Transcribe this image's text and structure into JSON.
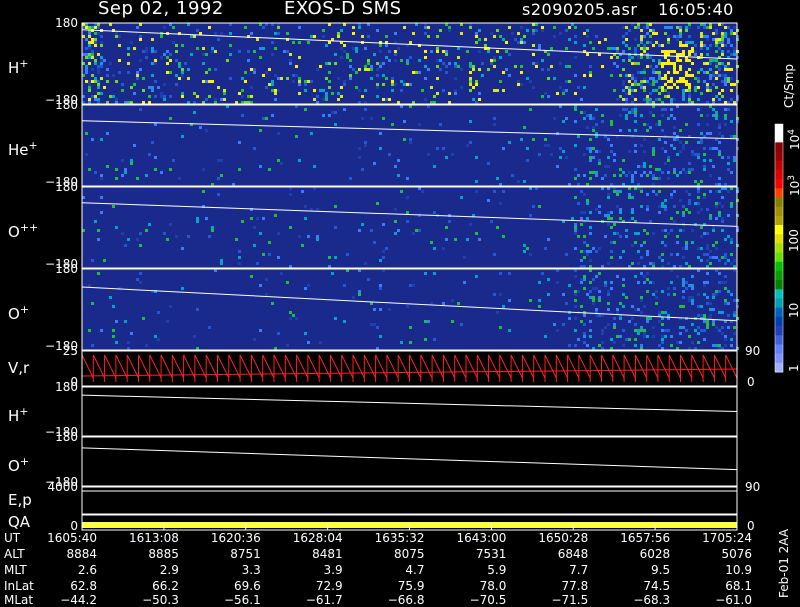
{
  "header": {
    "date": "Sep 02, 1992",
    "instrument": "EXOS-D SMS",
    "file": "s2090205.asr",
    "time": "16:05:40"
  },
  "colors": {
    "background": "#000000",
    "spectrogram_low": "#1a2a8c",
    "trace": "#ffffff",
    "velocity": "#ff2020",
    "qa": "#ffff40"
  },
  "panels": [
    {
      "label": "H",
      "sup": "+",
      "ytop": "180",
      "ybot": "−180"
    },
    {
      "label": "He",
      "sup": "+",
      "ytop": "180",
      "ybot": "−180"
    },
    {
      "label": "O",
      "sup": "++",
      "ytop": "180",
      "ybot": "−180"
    },
    {
      "label": "O",
      "sup": "+",
      "ytop": "180",
      "ybot": "−180"
    },
    {
      "label": "V,r",
      "sup": "",
      "ytop": "25",
      "ybot": "0",
      "right_top": "90",
      "right_bot": "0"
    },
    {
      "label": "H",
      "sup": "+",
      "ytop": "180",
      "ybot": "−180"
    },
    {
      "label": "O",
      "sup": "+",
      "ytop": "180",
      "ybot": "−180"
    },
    {
      "label": "E,p",
      "sup": "",
      "ytop": "4000",
      "right_top": "90"
    },
    {
      "label": "QA",
      "sup": "",
      "ybot": "0",
      "right_bot": "0"
    }
  ],
  "colorbar": {
    "unit": "Ct/Smp",
    "ticks": [
      "10",
      "10",
      "100",
      "10",
      "1"
    ],
    "tick_exps": [
      "4",
      "3",
      "",
      "",
      ""
    ],
    "colors": [
      "#ffffff",
      "#ffffff",
      "#8b0000",
      "#9b0000",
      "#c00000",
      "#e00000",
      "#ff0000",
      "#ff4000",
      "#808000",
      "#a09000",
      "#b0a000",
      "#ffff00",
      "#e0e000",
      "#a0e000",
      "#60e000",
      "#00c000",
      "#00a000",
      "#008000",
      "#00c0c0",
      "#00a0b0",
      "#0060c0",
      "#0040b0",
      "#2040c0",
      "#4060e0",
      "#6080ff",
      "#8090ff",
      "#a0b0ff"
    ]
  },
  "footer_note": "Feb-01 2AA",
  "ephemeris": {
    "row_labels": [
      "UT",
      "ALT",
      "MLT",
      "InLat",
      "MLat"
    ],
    "columns": [
      {
        "UT": "1605:40",
        "ALT": "8884",
        "MLT": "2.6",
        "InLat": "62.8",
        "MLat": "−44.2"
      },
      {
        "UT": "1613:08",
        "ALT": "8885",
        "MLT": "2.9",
        "InLat": "66.2",
        "MLat": "−50.3"
      },
      {
        "UT": "1620:36",
        "ALT": "8751",
        "MLT": "3.3",
        "InLat": "69.6",
        "MLat": "−56.1"
      },
      {
        "UT": "1628:04",
        "ALT": "8481",
        "MLT": "3.9",
        "InLat": "72.9",
        "MLat": "−61.7"
      },
      {
        "UT": "1635:32",
        "ALT": "8075",
        "MLT": "4.7",
        "InLat": "75.9",
        "MLat": "−66.8"
      },
      {
        "UT": "1643:00",
        "ALT": "7531",
        "MLT": "5.9",
        "InLat": "78.0",
        "MLat": "−70.5"
      },
      {
        "UT": "1650:28",
        "ALT": "6848",
        "MLT": "7.7",
        "InLat": "77.8",
        "MLat": "−71.5"
      },
      {
        "UT": "1657:56",
        "ALT": "6028",
        "MLT": "9.5",
        "InLat": "74.5",
        "MLat": "−68.3"
      },
      {
        "UT": "1705:24",
        "ALT": "5076",
        "MLT": "10.9",
        "InLat": "68.1",
        "MLat": "−61.0"
      }
    ]
  },
  "chart_data": {
    "type": "heatmap",
    "x_ticks": [
      "1605:40",
      "1613:08",
      "1620:36",
      "1628:04",
      "1635:32",
      "1643:00",
      "1650:28",
      "1657:56",
      "1705:24"
    ],
    "series": [
      {
        "name": "H+",
        "ylim": [
          -180,
          180
        ],
        "trace_start": 150,
        "trace_end": 20
      },
      {
        "name": "He+",
        "ylim": [
          -180,
          180
        ],
        "trace_start": 110,
        "trace_end": 30
      },
      {
        "name": "O++",
        "ylim": [
          -180,
          180
        ],
        "trace_start": 110,
        "trace_end": 5
      },
      {
        "name": "O+",
        "ylim": [
          -180,
          180
        ],
        "trace_start": 100,
        "trace_end": -50
      },
      {
        "name": "V,r",
        "ylim": [
          0,
          25
        ]
      },
      {
        "name": "H+",
        "ylim": [
          -180,
          180
        ],
        "trace_start": 120,
        "trace_end": 0
      },
      {
        "name": "O+",
        "ylim": [
          -180,
          180
        ],
        "trace_start": 100,
        "trace_end": -60
      },
      {
        "name": "E,p",
        "ylim": [
          0,
          4000
        ]
      },
      {
        "name": "QA",
        "ylim": [
          0,
          1
        ]
      }
    ],
    "colorbar_scale": "log",
    "colorbar_range": [
      1,
      10000
    ],
    "colorbar_unit": "Ct/Smp"
  }
}
